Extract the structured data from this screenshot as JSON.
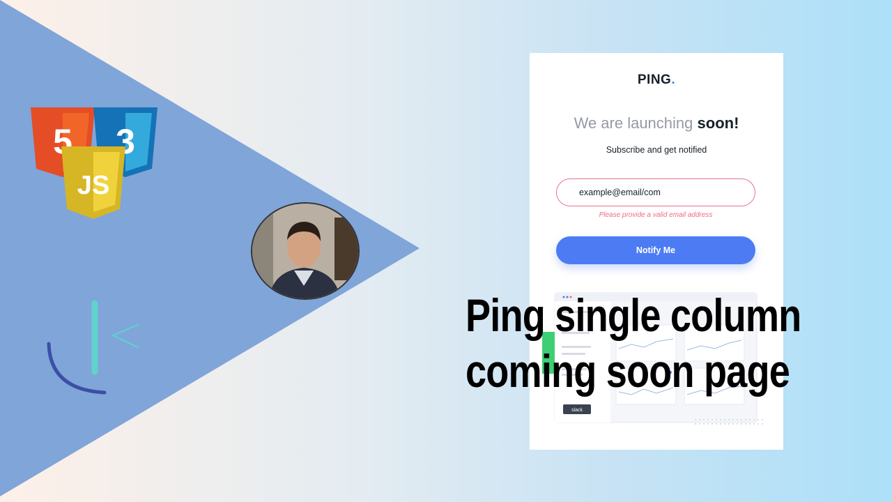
{
  "thumbnail": {
    "colors": {
      "triangle": "#7fa5d9",
      "html5": "#e44d26",
      "css3": "#2a8ad6",
      "js": "#e8c930"
    },
    "badges": [
      "html5-icon",
      "css3-icon",
      "js-icon"
    ],
    "html5_glyph": "5",
    "css3_glyph": "3",
    "js_glyph": "JS",
    "overlay_title_line1": "Ping single column",
    "overlay_title_line2": "coming soon page"
  },
  "page": {
    "logo": "PING",
    "logo_dot": ".",
    "headline_light": "We are launching ",
    "headline_bold": "soon!",
    "subtitle": "Subscribe and get notified",
    "email_value": "example@email/com",
    "error_message": "Please provide a valid email address",
    "button_label": "Notify Me",
    "colors": {
      "primary": "#4c7bf3",
      "error": "#f06a80",
      "dark": "#15202a",
      "muted": "#969aa6"
    },
    "dashboard_tag": "slack"
  }
}
